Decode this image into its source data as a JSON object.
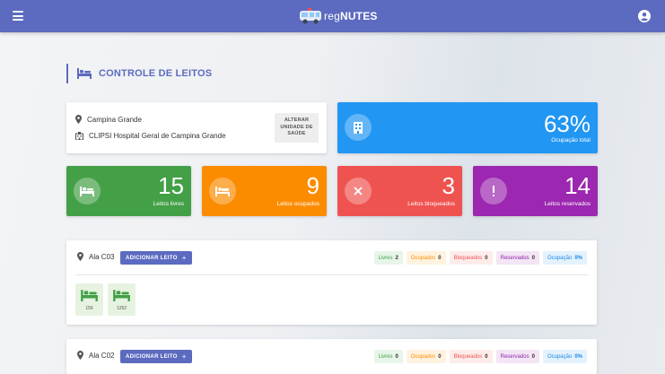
{
  "header": {
    "logo_prefix": "reg",
    "logo_bold": "NUTES"
  },
  "page": {
    "title": "CONTROLE DE LEITOS"
  },
  "location": {
    "city": "Campina Grande",
    "hospital": "CLIPSI Hospital Geral de Campina Grande",
    "alter_button": "ALTERAR\nUNIDADE DE\nSAÚDE"
  },
  "occupancy": {
    "value": "63%",
    "label": "Ocupação total"
  },
  "stats": [
    {
      "value": "15",
      "label": "Leitos livres",
      "color": "#43a047"
    },
    {
      "value": "9",
      "label": "Leitos ocupados",
      "color": "#fb8c00"
    },
    {
      "value": "3",
      "label": "Leitos bloqueados",
      "color": "#ef5350"
    },
    {
      "value": "14",
      "label": "Leitos reservados",
      "color": "#9c27b0"
    }
  ],
  "wards": [
    {
      "name": "Ala C03",
      "add_button": "ADICIONAR LEITO",
      "chips": [
        {
          "label": "Livres",
          "value": "2",
          "color": "#43a047",
          "bg": "#e8f5e9"
        },
        {
          "label": "Ocupados",
          "value": "0",
          "color": "#fb8c00",
          "bg": "#fff3e0"
        },
        {
          "label": "Bloqueados",
          "value": "0",
          "color": "#ef5350",
          "bg": "#fdecea"
        },
        {
          "label": "Reservados",
          "value": "0",
          "color": "#8e24aa",
          "bg": "#f3e5f5"
        },
        {
          "label": "Ocupação",
          "value": "0%",
          "color": "#1e88e5",
          "bg": "#e3f2fd"
        }
      ],
      "beds": [
        "156",
        "1252"
      ]
    },
    {
      "name": "Ala C02",
      "add_button": "ADICIONAR LEITO",
      "chips": [
        {
          "label": "Livres",
          "value": "0",
          "color": "#43a047",
          "bg": "#e8f5e9"
        },
        {
          "label": "Ocupados",
          "value": "0",
          "color": "#fb8c00",
          "bg": "#fff3e0"
        },
        {
          "label": "Bloqueados",
          "value": "0",
          "color": "#ef5350",
          "bg": "#fdecea"
        },
        {
          "label": "Reservados",
          "value": "0",
          "color": "#8e24aa",
          "bg": "#f3e5f5"
        },
        {
          "label": "Ocupação",
          "value": "0%",
          "color": "#1e88e5",
          "bg": "#e3f2fd"
        }
      ],
      "beds": []
    }
  ],
  "icons": {
    "menu": "menu-icon",
    "user": "account-icon",
    "title": "bed-icon",
    "location": "map-pin-icon",
    "hospital": "hospital-building-icon",
    "occupancy": "building-icon",
    "free": "bed-icon",
    "occupied": "bed-occupied-icon",
    "blocked": "close-icon",
    "reserved": "exclamation-icon"
  }
}
